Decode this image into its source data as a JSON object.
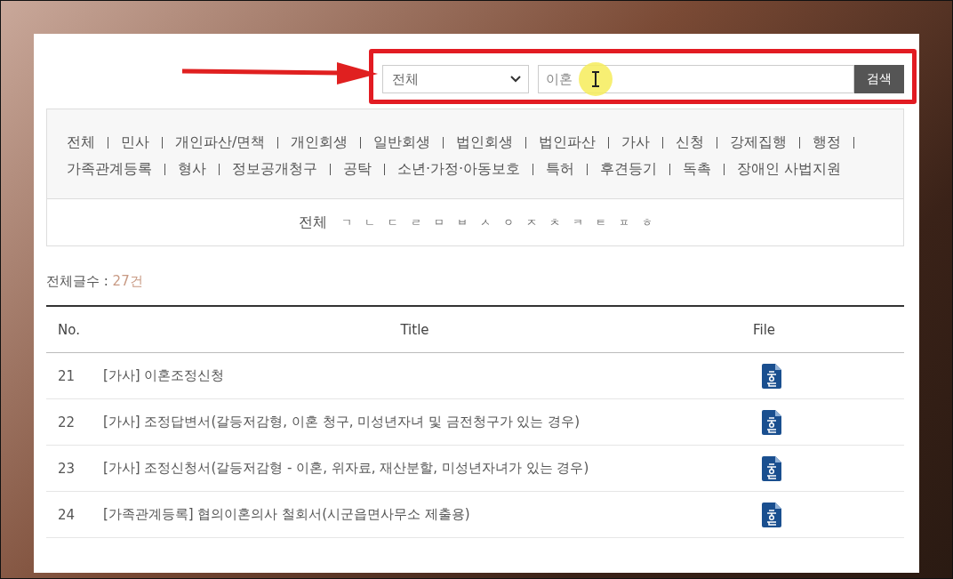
{
  "search": {
    "scope": "전체",
    "query": "이혼",
    "button": "검색"
  },
  "categories": [
    "전체",
    "민사",
    "개인파산/면책",
    "개인회생",
    "일반회생",
    "법인회생",
    "법인파산",
    "가사",
    "신청",
    "강제집행",
    "행정",
    "가족관계등록",
    "형사",
    "정보공개청구",
    "공탁",
    "소년·가정·아동보호",
    "특허",
    "후견등기",
    "독촉",
    "장애인 사법지원"
  ],
  "index": {
    "all": "전체",
    "letters": [
      "ㄱ",
      "ㄴ",
      "ㄷ",
      "ㄹ",
      "ㅁ",
      "ㅂ",
      "ㅅ",
      "ㅇ",
      "ㅈ",
      "ㅊ",
      "ㅋ",
      "ㅌ",
      "ㅍ",
      "ㅎ"
    ]
  },
  "count": {
    "label": "전체글수 :",
    "value": "27건"
  },
  "table": {
    "columns": [
      "No.",
      "Title",
      "File"
    ],
    "rows": [
      {
        "no": "21",
        "title": "[가사] 이혼조정신청"
      },
      {
        "no": "22",
        "title": "[가사] 조정답변서(갈등저감형, 이혼 청구, 미성년자녀 및 금전청구가 있는 경우)"
      },
      {
        "no": "23",
        "title": "[가사] 조정신청서(갈등저감형 - 이혼, 위자료, 재산분할, 미성년자녀가 있는 경우)"
      },
      {
        "no": "24",
        "title": "[가족관계등록] 협의이혼의사 철회서(시군읍면사무소 제출용)"
      }
    ]
  }
}
